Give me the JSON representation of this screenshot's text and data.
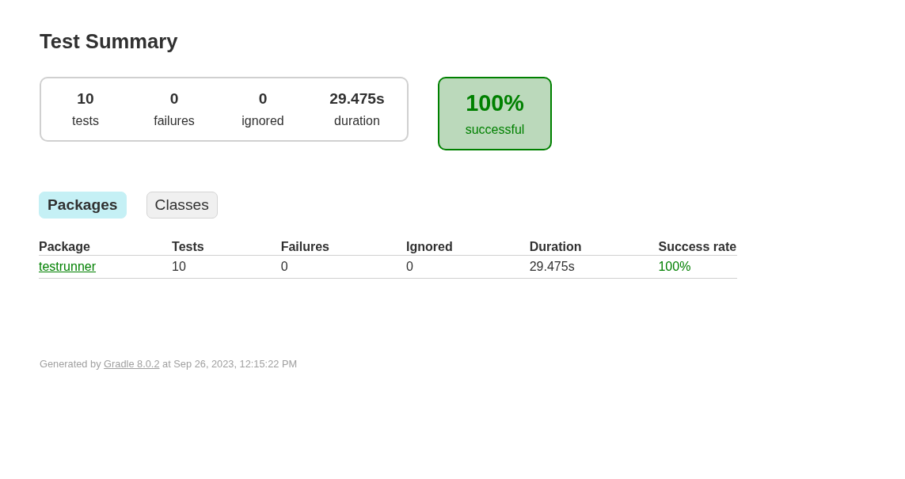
{
  "title": "Test Summary",
  "summary": {
    "counters": [
      {
        "value": "10",
        "label": "tests"
      },
      {
        "value": "0",
        "label": "failures"
      },
      {
        "value": "0",
        "label": "ignored"
      },
      {
        "value": "29.475s",
        "label": "duration"
      }
    ],
    "success_rate": {
      "value": "100%",
      "label": "successful",
      "passed": true
    }
  },
  "tabs": [
    {
      "label": "Packages",
      "selected": true
    },
    {
      "label": "Classes",
      "selected": false
    }
  ],
  "table": {
    "columns": [
      "Package",
      "Tests",
      "Failures",
      "Ignored",
      "Duration",
      "Success rate"
    ],
    "rows": [
      {
        "passed": true,
        "cells": [
          {
            "text": "testrunner",
            "kind": "link"
          },
          {
            "text": "10",
            "kind": "text"
          },
          {
            "text": "0",
            "kind": "text"
          },
          {
            "text": "0",
            "kind": "text"
          },
          {
            "text": "29.475s",
            "kind": "text"
          },
          {
            "text": "100%",
            "kind": "rate"
          }
        ]
      }
    ]
  },
  "footer": {
    "prefix": "Generated by",
    "link": "Gradle 8.0.2",
    "suffix": "at Sep 26, 2023, 12:15:22 PM"
  }
}
